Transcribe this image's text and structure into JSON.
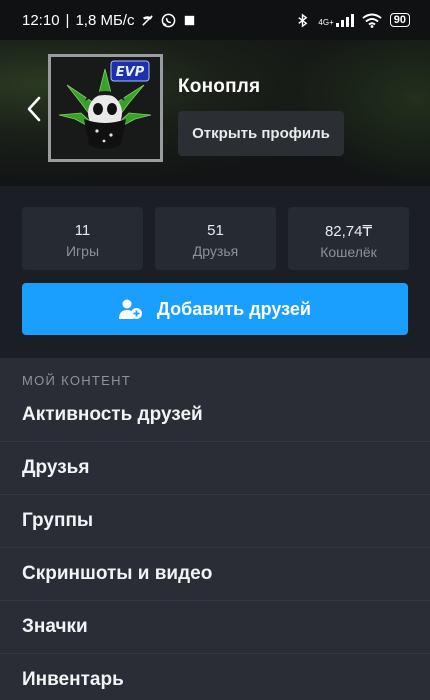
{
  "status_bar": {
    "time": "12:10",
    "speed": "1,8 МБ/с",
    "network": "4G+",
    "battery": "90",
    "icons": [
      "missed-call-icon",
      "whatsapp-icon",
      "stop-icon",
      "bluetooth-icon",
      "signal-icon",
      "wifi-icon",
      "battery-icon"
    ]
  },
  "profile": {
    "name": "Конопля",
    "open_profile_label": "Открыть профиль",
    "avatar_text": "EVP"
  },
  "stats": [
    {
      "value": "11",
      "label": "Игры"
    },
    {
      "value": "51",
      "label": "Друзья"
    },
    {
      "value": "82,74₸",
      "label": "Кошелёк"
    }
  ],
  "add_friends_label": "Добавить друзей",
  "menu": {
    "section_title": "МОЙ КОНТЕНТ",
    "items": [
      "Активность друзей",
      "Друзья",
      "Группы",
      "Скриншоты и видео",
      "Значки",
      "Инвентарь"
    ]
  },
  "colors": {
    "accent": "#1a9fff",
    "background": "#1b1e25",
    "menu_background": "#2a2d35",
    "card": "#262a33"
  }
}
